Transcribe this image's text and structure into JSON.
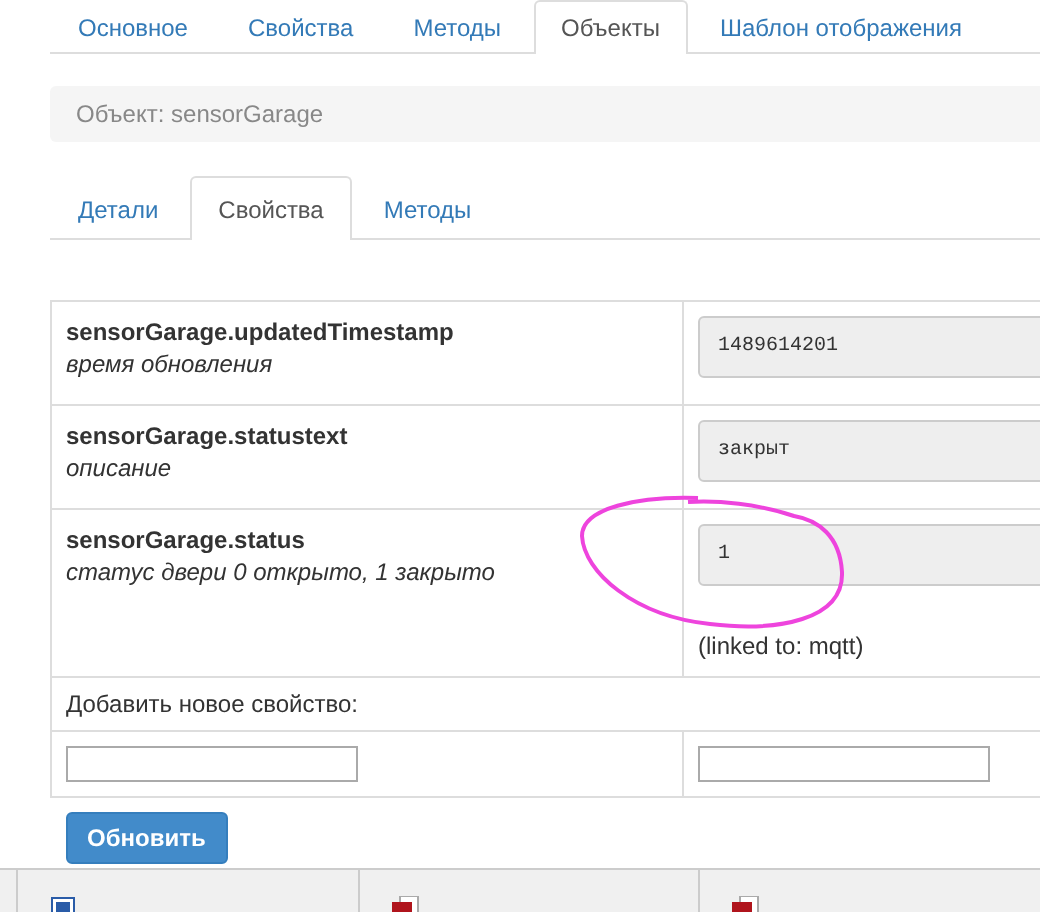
{
  "top_tabs": [
    {
      "label": "Основное",
      "selected": false
    },
    {
      "label": "Свойства",
      "selected": false
    },
    {
      "label": "Методы",
      "selected": false
    },
    {
      "label": "Объекты",
      "selected": true
    },
    {
      "label": "Шаблон отображения",
      "selected": false
    }
  ],
  "object_header": "Объект: sensorGarage",
  "sub_tabs": [
    {
      "label": "Детали",
      "selected": false
    },
    {
      "label": "Свойства",
      "selected": true
    },
    {
      "label": "Методы",
      "selected": false
    }
  ],
  "properties": [
    {
      "name": "sensorGarage.updatedTimestamp",
      "description": "время обновления",
      "value": "1489614201",
      "highlighted": false
    },
    {
      "name": "sensorGarage.statustext",
      "description": "описание",
      "value": "закрыт",
      "highlighted": false
    },
    {
      "name": "sensorGarage.status",
      "description": "статус двери 0 открыто, 1 закрыто",
      "value": "1",
      "linked_to": "(linked to: mqtt)",
      "highlighted": true
    }
  ],
  "add_property_label": "Добавить новое свойство:",
  "submit_button": "Обновить",
  "downloads": [
    {
      "kind": "doc"
    },
    {
      "kind": "pdf"
    },
    {
      "kind": "pdf"
    }
  ]
}
